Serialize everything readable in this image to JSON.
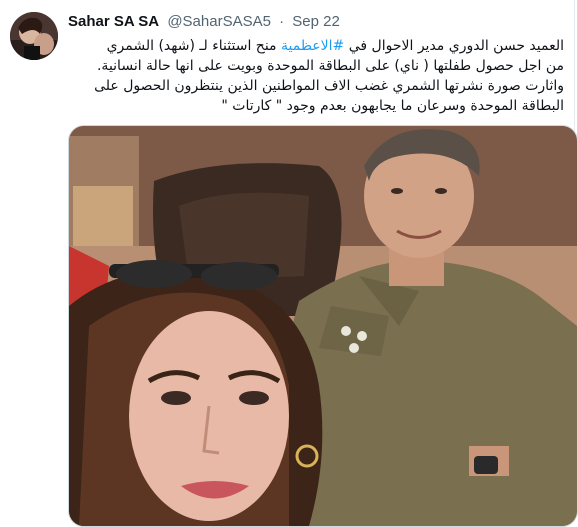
{
  "tweet": {
    "author": {
      "display_name": "Sahar SA SA",
      "handle": "@SaharSASA5",
      "avatar_icon": "profile-photo"
    },
    "separator": "·",
    "date": "Sep 22",
    "text": {
      "l1_a": "العميد حسن الدوري  مدير الاحوال في",
      "l1_hashtag": "#الاعظمية",
      "l1_b": "منح استثناء لـ (شهد)  الشمري",
      "l2": "من اجل حصول طفلتها ( ناي) على البطاقة الموحدة وبويت على انها حالة انسانية.",
      "l3": "واثارت صورة نشرتها الشمري غضب الاف المواطنين الذين ينتظرون الحصول على",
      "l4": "البطاقة الموحدة وسرعان ما يجابهون بعدم وجود \" كارتات \""
    },
    "media": {
      "type": "photo"
    }
  },
  "colors": {
    "hashtag": "#1d9bf0",
    "secondary_text": "#536471",
    "border": "#cfd9de"
  }
}
